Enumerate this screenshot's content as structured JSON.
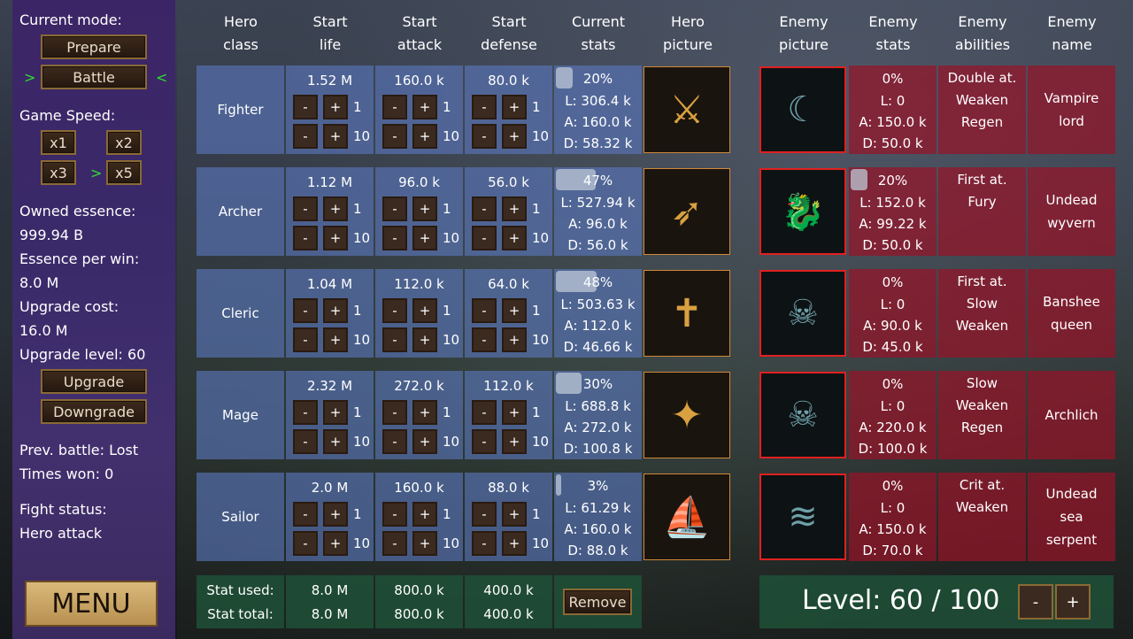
{
  "sidebar": {
    "current_mode_label": "Current mode:",
    "prepare_label": "Prepare",
    "battle_label": "Battle",
    "mode_marker_left": ">",
    "mode_marker_right": "<",
    "game_speed_label": "Game Speed:",
    "speeds": [
      "x1",
      "x2",
      "x3",
      "x5"
    ],
    "speed_marker": ">",
    "owned_essence_label": "Owned essence:",
    "owned_essence_value": "999.94 B",
    "essence_per_win_label": "Essence per win:",
    "essence_per_win_value": "8.0 M",
    "upgrade_cost_label": "Upgrade cost:",
    "upgrade_cost_value": "16.0 M",
    "upgrade_level_text": "Upgrade level: 60",
    "upgrade_label": "Upgrade",
    "downgrade_label": "Downgrade",
    "prev_battle_text": "Prev. battle: Lost",
    "times_won_text": "Times won: 0",
    "fight_status_label": "Fight status:",
    "fight_status_value": "Hero attack",
    "menu_label": "MENU"
  },
  "headers": {
    "hero_class": [
      "Hero",
      "class"
    ],
    "start_life": [
      "Start",
      "life"
    ],
    "start_attack": [
      "Start",
      "attack"
    ],
    "start_defense": [
      "Start",
      "defense"
    ],
    "current_stats": [
      "Current",
      "stats"
    ],
    "hero_picture": [
      "Hero",
      "picture"
    ],
    "enemy_picture": [
      "Enemy",
      "picture"
    ],
    "enemy_stats": [
      "Enemy",
      "stats"
    ],
    "enemy_abilities": [
      "Enemy",
      "abilities"
    ],
    "enemy_name": [
      "Enemy",
      "name"
    ]
  },
  "controls": {
    "minus": "-",
    "plus": "+",
    "step_small": "1",
    "step_large": "10"
  },
  "rows": [
    {
      "hero_class": "Fighter",
      "start_life": "1.52 M",
      "start_attack": "160.0 k",
      "start_defense": "80.0 k",
      "progress_text": "20%",
      "progress_fraction": 0.2,
      "cur_l": "L: 306.4 k",
      "cur_a": "A: 160.0 k",
      "cur_d": "D: 58.32 k",
      "hero_picture_icon": "fighter-portrait",
      "enemy_picture_icon": "vampire-lord-portrait",
      "enemy_progress_text": "0%",
      "enemy_progress_fraction": 0,
      "enemy_l": "L: 0",
      "enemy_a": "A: 150.0 k",
      "enemy_d": "D: 50.0 k",
      "enemy_abilities": [
        "Double at.",
        "Weaken",
        "Regen"
      ],
      "enemy_name": [
        "Vampire",
        "lord"
      ]
    },
    {
      "hero_class": "Archer",
      "start_life": "1.12 M",
      "start_attack": "96.0 k",
      "start_defense": "56.0 k",
      "progress_text": "47%",
      "progress_fraction": 0.47,
      "cur_l": "L: 527.94 k",
      "cur_a": "A: 96.0 k",
      "cur_d": "D: 56.0 k",
      "hero_picture_icon": "archer-portrait",
      "enemy_picture_icon": "undead-wyvern-portrait",
      "enemy_progress_text": "20%",
      "enemy_progress_fraction": 0.2,
      "enemy_l": "L: 152.0 k",
      "enemy_a": "A: 99.22 k",
      "enemy_d": "D: 50.0 k",
      "enemy_abilities": [
        "First at.",
        "Fury"
      ],
      "enemy_name": [
        "Undead",
        "wyvern"
      ]
    },
    {
      "hero_class": "Cleric",
      "start_life": "1.04 M",
      "start_attack": "112.0 k",
      "start_defense": "64.0 k",
      "progress_text": "48%",
      "progress_fraction": 0.48,
      "cur_l": "L: 503.63 k",
      "cur_a": "A: 112.0 k",
      "cur_d": "D: 46.66 k",
      "hero_picture_icon": "cleric-portrait",
      "enemy_picture_icon": "banshee-queen-portrait",
      "enemy_progress_text": "0%",
      "enemy_progress_fraction": 0,
      "enemy_l": "L: 0",
      "enemy_a": "A: 90.0 k",
      "enemy_d": "D: 45.0 k",
      "enemy_abilities": [
        "First at.",
        "Slow",
        "Weaken"
      ],
      "enemy_name": [
        "Banshee",
        "queen"
      ]
    },
    {
      "hero_class": "Mage",
      "start_life": "2.32 M",
      "start_attack": "272.0 k",
      "start_defense": "112.0 k",
      "progress_text": "30%",
      "progress_fraction": 0.3,
      "cur_l": "L: 688.8 k",
      "cur_a": "A: 272.0 k",
      "cur_d": "D: 100.8 k",
      "hero_picture_icon": "mage-portrait",
      "enemy_picture_icon": "archlich-portrait",
      "enemy_progress_text": "0%",
      "enemy_progress_fraction": 0,
      "enemy_l": "L: 0",
      "enemy_a": "A: 220.0 k",
      "enemy_d": "D: 100.0 k",
      "enemy_abilities": [
        "Slow",
        "Weaken",
        "Regen"
      ],
      "enemy_name": [
        "Archlich"
      ]
    },
    {
      "hero_class": "Sailor",
      "start_life": "2.0 M",
      "start_attack": "160.0 k",
      "start_defense": "88.0 k",
      "progress_text": "3%",
      "progress_fraction": 0.03,
      "cur_l": "L: 61.29 k",
      "cur_a": "A: 160.0 k",
      "cur_d": "D: 88.0 k",
      "hero_picture_icon": "ship-portrait",
      "enemy_picture_icon": "undead-sea-serpent-portrait",
      "enemy_progress_text": "0%",
      "enemy_progress_fraction": 0,
      "enemy_l": "L: 0",
      "enemy_a": "A: 150.0 k",
      "enemy_d": "D: 70.0 k",
      "enemy_abilities": [
        "Crit at.",
        "Weaken"
      ],
      "enemy_name": [
        "Undead",
        "sea",
        "serpent"
      ]
    }
  ],
  "footer": {
    "stat_used_label": "Stat used:",
    "stat_total_label": "Stat total:",
    "life_used": "8.0 M",
    "life_total": "8.0 M",
    "attack_used": "800.0 k",
    "attack_total": "800.0 k",
    "defense_used": "400.0 k",
    "defense_total": "400.0 k",
    "remove_label": "Remove",
    "level_text": "Level: 60 / 100",
    "level_minus": "-",
    "level_plus": "+"
  },
  "colors": {
    "hero_cell": "#5a78be",
    "enemy_cell": "#961428",
    "footer": "#1e5037",
    "sidebar": "#3c2566",
    "marker": "#2fdc2f"
  }
}
